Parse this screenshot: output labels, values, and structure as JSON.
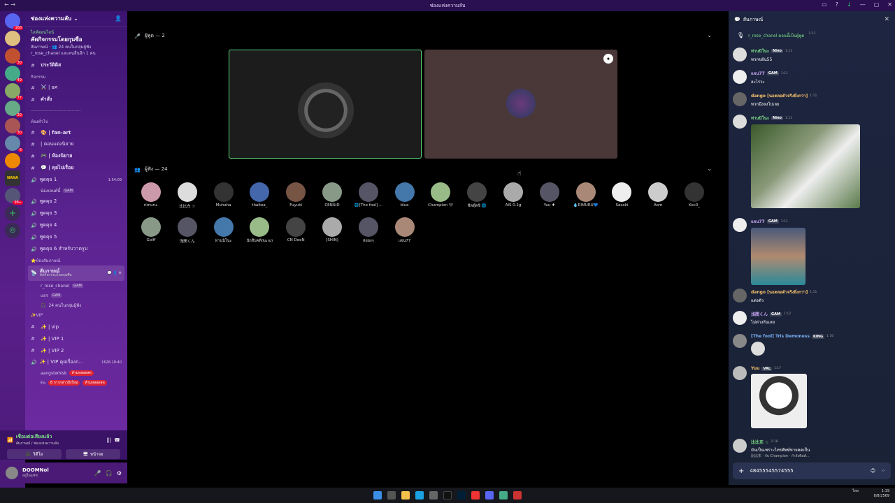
{
  "window": {
    "title": "ช่องแห่งความลับ"
  },
  "server": {
    "name": "ช่องแห่งความลับ",
    "icon_badges": [
      "168",
      "30",
      "49",
      "77",
      "20",
      "30",
      "6",
      "96+"
    ],
    "nana_label": "NANA"
  },
  "event": {
    "live": "ไลฟ์ออนไลน์",
    "title": "คัดกิจกรรมโดยกุนซือ",
    "meta": "สัมภาษณ์ · 👥 24 คนในกลุ่มผู้ฟัง",
    "note": "r_rose_chanel และคนอื่นอีก 1 คน"
  },
  "channels": {
    "history": "ประวัติดิส",
    "cat_rules": "กิจกรรม",
    "ch_role": "⚔️ | ยศ",
    "ch_cmd": "คำสั่ง",
    "cat_general": "ห้องทั่วไป",
    "ch_fanart": "🎨 | fan-art",
    "ch_novel_open": "| ตอนแต่งนิยาย",
    "ch_novel": "🎮 | ห้องนิยาย",
    "ch_chat": "💬 | คุยไปเรื่อย",
    "voice1": "พูดคุย 1",
    "voice1_time": "1:54:09",
    "voice1_user": "น้องเจนต์นี้",
    "voice1_user_tag": "GAM",
    "voice2": "พูดคุย 2",
    "voice3": "พูดคุย 3",
    "voice4": "พูดคุย 4",
    "voice5": "พูดคุย 5",
    "voice6": "พูดคุย 6 สำหรับวาดรูป",
    "cat_stage": "⭐ห้องสัมภาษณ์",
    "stage": "สัมภาษณ์",
    "stage_sub": "คัดกิจกรรมโดยกุนซือ",
    "stage_user1": "r_rose_chanel",
    "stage_user1_tag": "GAM",
    "stage_user2": "แอร",
    "stage_user2_tag": "GAM",
    "stage_audience": "24 คนในกลุ่มผู้ฟัง",
    "cat_vip": "✨VIP",
    "vip1": "✨ | vip",
    "vip2": "✨ | VIP 1",
    "vip3": "✨ | VIP 2",
    "vip4": "✨ | VIP คุยเรื่องก...",
    "vip4_time": "1626:18:40",
    "vip_user1": "aangstwhisk",
    "vip_user1_tag": "ห้ามหลอดสด",
    "vip_user2": "Fo",
    "vip_user2_tag": "ห้ามหลอดสด",
    "unread_toast": "8 การกล่าวถึงใหม่"
  },
  "voice": {
    "status": "เชื่อมต่อเสียงแล้ว",
    "location": "สัมภาษณ์ / ช่องแห่งความลับ",
    "btn_video": "วิดีโอ",
    "btn_screen": "หน้าจอ"
  },
  "user": {
    "name": "DOOMNol",
    "status": "อยู่ในแชท"
  },
  "stage_view": {
    "speakers_header": "ผู้พูด — 2",
    "audience_header": "ผู้ฟัง — 24",
    "audience_row1": [
      "rimuru.",
      "比比东 ☆",
      "Muhaha",
      "thaitea_",
      "Fuyuki",
      "CENIUD",
      "🌐[The fool] ...",
      "blue",
      "Champion 🖤",
      "ซี่ตตุ๊ตซิ 🌐",
      "AIS 0.1g",
      "Yuu ♦",
      "💧RIMURU💙",
      "Sasaki",
      "Aom",
      "Koc0_"
    ],
    "audience_row2": [
      "Golff",
      "浅間くん",
      "ท่านนิโนะ",
      "นักสืบคดี(kuro)",
      "CN DeeN",
      "[SHIN]",
      "หยองๆ",
      "แจน77"
    ]
  },
  "chat": {
    "title": "สัมภาษณ์",
    "notice": "r_rose_chanel ตอนนี้เป็นผู้พูด",
    "notice_time": "1:11",
    "messages": [
      {
        "name": "ท่านนิโนะ",
        "tag": "Nino",
        "time": "1:11",
        "text": "พวกขยัน55"
      },
      {
        "name": "แจน77",
        "tag": "GAM",
        "time": "1:11",
        "text": "อะไรวะ"
      },
      {
        "name": "dango [นอตลอตัวจริงยิ่งกว่า]",
        "tag": "",
        "time": "1:11",
        "text": "พวกมึงลงไปเลย"
      },
      {
        "name": "ท่านนิโนะ",
        "tag": "Nino",
        "time": "1:11",
        "text": ""
      },
      {
        "name": "แจน77",
        "tag": "GAM",
        "time": "1:11",
        "text": ""
      },
      {
        "name": "dango [นอตลอตัวจริงยิ่งกว่า]",
        "tag": "",
        "time": "1:11",
        "text": "แต่งตัว"
      },
      {
        "name": "浅間くん",
        "tag": "GAM",
        "time": "1:12",
        "text": "ไม่ต่างกันเลย"
      },
      {
        "name": "[The fool] Tris Demoness",
        "tag": "KING",
        "time": "1:16",
        "text": ""
      },
      {
        "name": "Yuu",
        "tag": "VAL",
        "time": "1:17",
        "text": ""
      },
      {
        "name": "比比东 ☆",
        "tag": "",
        "time": "1:18",
        "text": "มันเป็นเพราะไทรศัพท์หายคดเป็น"
      }
    ],
    "typing": "比比东 · กับ Champion · กำลังพิมพ์...",
    "input_value": "48455545574555"
  },
  "tray": {
    "lang": "ไทย",
    "time": "1:19",
    "date": "8/8/2569"
  }
}
